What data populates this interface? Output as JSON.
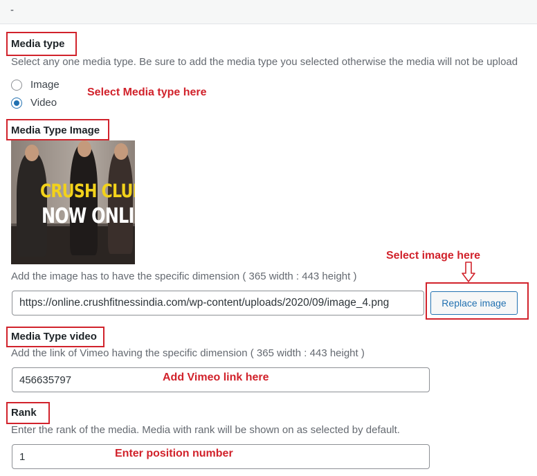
{
  "topbar": {
    "text": "-"
  },
  "media_type": {
    "heading": "Media type",
    "description": "Select any one media type. Be sure to add the media type you selected otherwise the media will not be upload",
    "options": [
      {
        "label": "Image",
        "checked": false
      },
      {
        "label": "Video",
        "checked": true
      }
    ],
    "annotation": "Select Media type here"
  },
  "media_type_image": {
    "heading": "Media Type Image",
    "thumbnail": {
      "line1": "CRUSH CLUB",
      "line2": "NOW ONLINE."
    },
    "annotation": "Select image here",
    "description": "Add the image has to have the specific dimension ( 365 width : 443 height )",
    "url_value": "https://online.crushfitnessindia.com/wp-content/uploads/2020/09/image_4.png",
    "replace_button": "Replace image"
  },
  "media_type_video": {
    "heading": "Media Type video",
    "description": "Add the link of Vimeo having the specific dimension ( 365 width : 443 height )",
    "value": "456635797",
    "annotation": "Add Vimeo link here"
  },
  "rank": {
    "heading": "Rank",
    "description": "Enter the rank of the media. Media with rank will be shown on as selected by default.",
    "value": "1",
    "annotation": "Enter position number"
  },
  "colors": {
    "annotation_red": "#d1222b",
    "accent_blue": "#2271b1",
    "thumbnail_yellow": "#f2d21b"
  }
}
